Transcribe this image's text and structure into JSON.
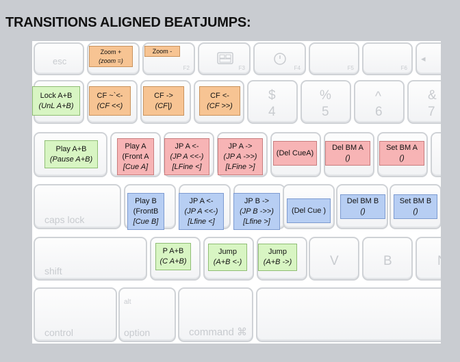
{
  "title": "TRANSITIONS ALIGNED BEATJUMPS:",
  "keys": {
    "esc": "esc",
    "f2": "F2",
    "f3": "F3",
    "f4": "F4",
    "f5": "F5",
    "f6": "F6",
    "dollar": "$",
    "four": "4",
    "percent": "%",
    "five": "5",
    "caret": "^",
    "six": "6",
    "amp": "&",
    "seven": "7",
    "caps_lock": "caps lock",
    "shift": "shift",
    "v": "V",
    "b": "B",
    "n": "N",
    "control": "control",
    "alt": "alt",
    "option": "option",
    "command": "command ⌘"
  },
  "overlays": {
    "zoom_plus": [
      "Zoom +",
      "(zoom =)"
    ],
    "zoom_minus": [
      "Zoom -"
    ],
    "lock_ab": [
      "Lock A+B",
      "(UnL A+B)"
    ],
    "cf_mid": [
      "CF ~`<-",
      "(CF <<)"
    ],
    "cf_right": [
      "CF ->",
      "(CF|)"
    ],
    "cf_left": [
      "CF <-",
      "(CF >>)"
    ],
    "play_ab": [
      "Play A+B",
      "(Pause A+B)"
    ],
    "play_a": [
      "Play A",
      "(Front A",
      "[Cue A]"
    ],
    "jp_a_back": [
      "JP A <-",
      "(JP A <<-)",
      "[LFine <]"
    ],
    "jp_a_fwd": [
      "JP A ->",
      "(JP A ->>)",
      "[LFine >]"
    ],
    "del_cue_a": [
      "(Del CueA)"
    ],
    "del_bm_a": [
      "Del BM A",
      "()"
    ],
    "set_bm_a": [
      "Set BM A",
      "()"
    ],
    "play_b": [
      "Play B",
      "(FrontB",
      "[Cue B]"
    ],
    "jp_b_back": [
      "JP A <-",
      "(JP A <<-)",
      "[Lfine <]"
    ],
    "jp_b_fwd": [
      "JP B ->",
      "(JP B ->>)",
      "[Lfine >]"
    ],
    "del_cue_b": [
      "(Del Cue )"
    ],
    "del_bm_b": [
      "Del BM B",
      "()"
    ],
    "set_bm_b": [
      "Set BM B",
      "()"
    ],
    "p_ab": [
      "P A+B",
      "(C A+B)"
    ],
    "jump_back": [
      "Jump",
      "(A+B <-)"
    ],
    "jump_fwd": [
      "Jump",
      "(A+B ->)"
    ]
  },
  "colors": {
    "orange": "#f7c493",
    "green": "#d8f5c3",
    "red": "#f7b4b5",
    "blue": "#b7cef3"
  }
}
